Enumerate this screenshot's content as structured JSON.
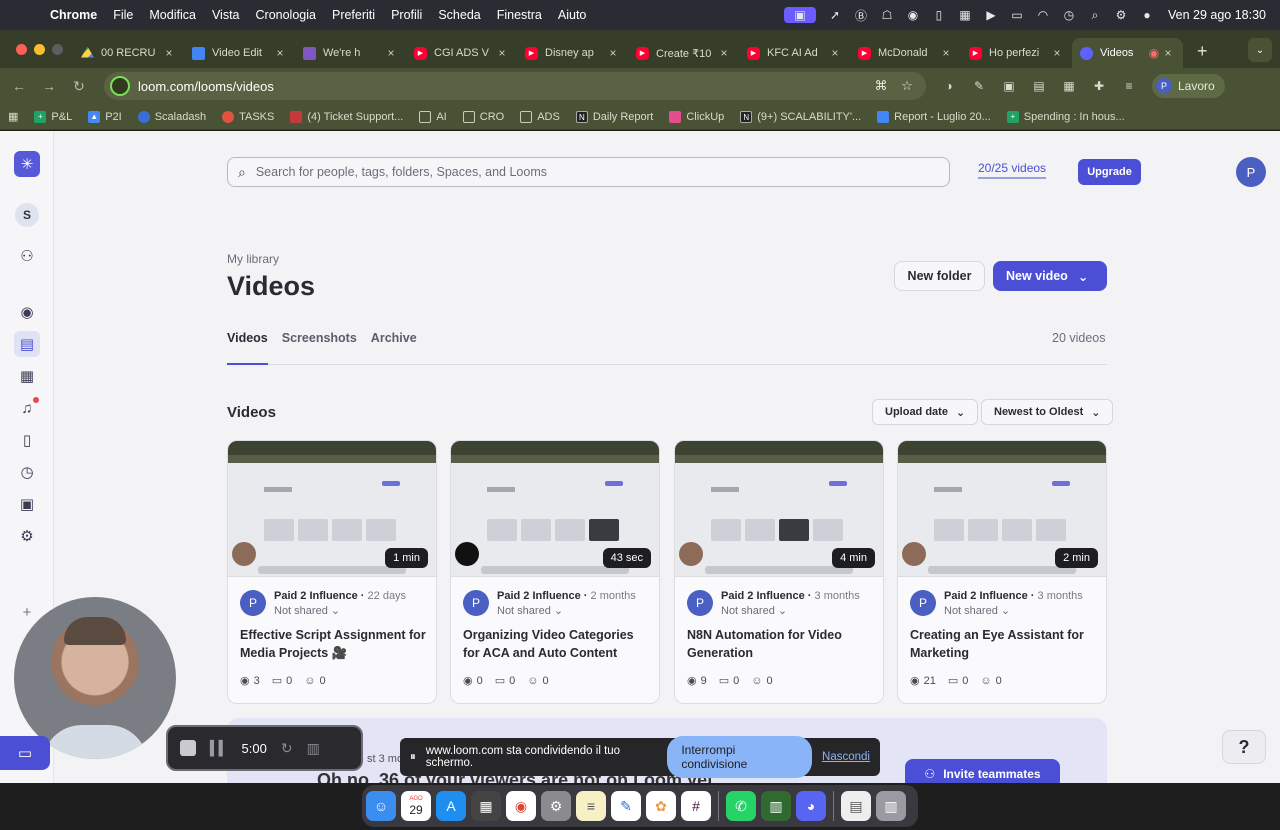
{
  "menubar": {
    "app": "Chrome",
    "menus": [
      "File",
      "Modifica",
      "Vista",
      "Cronologia",
      "Preferiti",
      "Profili",
      "Scheda",
      "Finestra",
      "Aiuto"
    ],
    "datetime": "Ven 29 ago  18:30"
  },
  "tabs": [
    {
      "title": "00 RECRU",
      "icon": "drive"
    },
    {
      "title": "Video Edit",
      "icon": "docs"
    },
    {
      "title": "We're h",
      "icon": "form"
    },
    {
      "title": "CGI ADS V",
      "icon": "yt"
    },
    {
      "title": "Disney ap",
      "icon": "yt"
    },
    {
      "title": "Create ₹10",
      "icon": "yt"
    },
    {
      "title": "KFC AI Ad",
      "icon": "yt"
    },
    {
      "title": "McDonald",
      "icon": "yt"
    },
    {
      "title": "Ho perfezi",
      "icon": "yt"
    },
    {
      "title": "Videos",
      "icon": "loom",
      "active": true
    }
  ],
  "address": {
    "url": "loom.com/looms/videos",
    "profile": "Lavoro",
    "profile_initial": "P"
  },
  "bookmarks": [
    "P&L",
    "P2I",
    "Scaladash",
    "TASKS",
    "(4) Ticket Support...",
    "AI",
    "CRO",
    "ADS",
    "Daily Report",
    "ClickUp",
    "(9+) SCALABILITY'...",
    "Report - Luglio 20...",
    "Spending : In hous..."
  ],
  "loom": {
    "workspace_initial": "S",
    "search_placeholder": "Search for people, tags, folders, Spaces, and Looms",
    "video_quota": "20/25 videos",
    "upgrade_label": "Upgrade",
    "user_initial": "P",
    "breadcrumb": "My library",
    "title": "Videos",
    "new_folder_label": "New folder",
    "new_video_label": "New video",
    "tabs": [
      "Videos",
      "Screenshots",
      "Archive"
    ],
    "total_count": "20 videos",
    "section_title": "Videos",
    "sort_upload": "Upload date",
    "sort_order": "Newest to Oldest",
    "cards": [
      {
        "author": "Paid 2 Influence",
        "ago": "22 days",
        "sharing": "Not shared",
        "duration": "1 min",
        "title": "Effective Script Assignment for Media Projects 🎥",
        "views": "3",
        "comments": "0",
        "reactions": "0"
      },
      {
        "author": "Paid 2 Influence",
        "ago": "2 months",
        "sharing": "Not shared",
        "duration": "43 sec",
        "title": "Organizing Video Categories for ACA and Auto Content",
        "views": "0",
        "comments": "0",
        "reactions": "0"
      },
      {
        "author": "Paid 2 Influence",
        "ago": "3 months",
        "sharing": "Not shared",
        "duration": "4 min",
        "title": "N8N Automation for Video Generation",
        "views": "9",
        "comments": "0",
        "reactions": "0"
      },
      {
        "author": "Paid 2 Influence",
        "ago": "3 months",
        "sharing": "Not shared",
        "duration": "2 min",
        "title": "Creating an Eye Assistant for Marketing",
        "views": "21",
        "comments": "0",
        "reactions": "0"
      }
    ],
    "banner_sub": "st 3 mo",
    "banner_headline": "Oh no, 36 of your viewers are not on Loom yet",
    "invite_label": "Invite teammates",
    "help_label": "?"
  },
  "recorder": {
    "time": "5:00"
  },
  "share_bar": {
    "message": "www.loom.com sta condividendo il tuo schermo.",
    "stop_label": "Interrompi condivisione",
    "hide_label": "Nascondi"
  },
  "dock": {
    "calendar_month": "AGO",
    "calendar_day": "29"
  }
}
